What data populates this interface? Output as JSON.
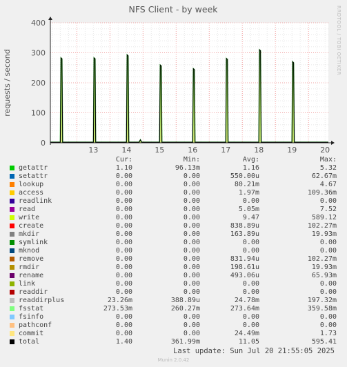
{
  "watermark": "RRDTOOL / TOBI OETIKER",
  "chart_data": {
    "type": "line",
    "title": "NFS Client - by week",
    "xlabel": "",
    "ylabel": "requests / second",
    "xlim": [
      12.2,
      20.6
    ],
    "ylim": [
      0,
      400
    ],
    "x_ticks": [
      "13",
      "14",
      "15",
      "16",
      "17",
      "18",
      "19",
      "20"
    ],
    "x_tick_values": [
      13,
      14,
      15,
      16,
      17,
      18,
      19,
      20
    ],
    "y_ticks": [
      "0",
      "100",
      "200",
      "300",
      "400"
    ],
    "y_tick_values": [
      0,
      100,
      200,
      300,
      400
    ],
    "grid": true,
    "series": [
      {
        "name": "total",
        "color": "#000000",
        "x": [
          12.2,
          12.5,
          12.52,
          12.55,
          12.57,
          12.6,
          13.5,
          13.52,
          13.55,
          13.57,
          13.6,
          14.5,
          14.52,
          14.55,
          14.57,
          14.6,
          14.88,
          14.92,
          14.96,
          15.5,
          15.52,
          15.55,
          15.57,
          15.6,
          16.5,
          16.52,
          16.55,
          16.57,
          16.6,
          17.5,
          17.52,
          17.55,
          17.57,
          17.6,
          18.5,
          18.52,
          18.55,
          18.57,
          18.6,
          19.5,
          19.52,
          19.55,
          19.57,
          19.6,
          20.6
        ],
        "y": [
          2,
          2,
          283,
          280,
          2,
          2,
          2,
          283,
          280,
          2,
          2,
          2,
          293,
          290,
          2,
          2,
          2,
          10,
          2,
          2,
          259,
          256,
          2,
          2,
          2,
          247,
          244,
          2,
          2,
          2,
          281,
          278,
          2,
          2,
          2,
          310,
          307,
          2,
          2,
          2,
          270,
          267,
          2,
          2,
          2
        ]
      }
    ],
    "legend_headers": {
      "cur": "Cur:",
      "min": "Min:",
      "avg": "Avg:",
      "max": "Max:"
    },
    "legend": [
      {
        "name": "getattr",
        "color": "#00cc00",
        "cur": "1.10",
        "min": "96.13m",
        "avg": "1.16",
        "max": "5.32"
      },
      {
        "name": "setattr",
        "color": "#0066b3",
        "cur": "0.00",
        "min": "0.00",
        "avg": "550.00u",
        "max": "62.67m"
      },
      {
        "name": "lookup",
        "color": "#ff8000",
        "cur": "0.00",
        "min": "0.00",
        "avg": "80.21m",
        "max": "4.67"
      },
      {
        "name": "access",
        "color": "#ffcc00",
        "cur": "0.00",
        "min": "0.00",
        "avg": "1.97m",
        "max": "109.36m"
      },
      {
        "name": "readlink",
        "color": "#330099",
        "cur": "0.00",
        "min": "0.00",
        "avg": "0.00",
        "max": "0.00"
      },
      {
        "name": "read",
        "color": "#990099",
        "cur": "0.00",
        "min": "0.00",
        "avg": "5.05m",
        "max": "7.52"
      },
      {
        "name": "write",
        "color": "#ccff00",
        "cur": "0.00",
        "min": "0.00",
        "avg": "9.47",
        "max": "589.12"
      },
      {
        "name": "create",
        "color": "#ff0000",
        "cur": "0.00",
        "min": "0.00",
        "avg": "838.89u",
        "max": "102.27m"
      },
      {
        "name": "mkdir",
        "color": "#808080",
        "cur": "0.00",
        "min": "0.00",
        "avg": "163.89u",
        "max": "19.93m"
      },
      {
        "name": "symlink",
        "color": "#008f00",
        "cur": "0.00",
        "min": "0.00",
        "avg": "0.00",
        "max": "0.00"
      },
      {
        "name": "mknod",
        "color": "#00487d",
        "cur": "0.00",
        "min": "0.00",
        "avg": "0.00",
        "max": "0.00"
      },
      {
        "name": "remove",
        "color": "#b35a00",
        "cur": "0.00",
        "min": "0.00",
        "avg": "831.94u",
        "max": "102.27m"
      },
      {
        "name": "rmdir",
        "color": "#b38f00",
        "cur": "0.00",
        "min": "0.00",
        "avg": "198.61u",
        "max": "19.93m"
      },
      {
        "name": "rename",
        "color": "#6b006b",
        "cur": "0.00",
        "min": "0.00",
        "avg": "493.06u",
        "max": "65.93m"
      },
      {
        "name": "link",
        "color": "#8fb300",
        "cur": "0.00",
        "min": "0.00",
        "avg": "0.00",
        "max": "0.00"
      },
      {
        "name": "readdir",
        "color": "#b30000",
        "cur": "0.00",
        "min": "0.00",
        "avg": "0.00",
        "max": "0.00"
      },
      {
        "name": "readdirplus",
        "color": "#bebebe",
        "cur": "23.26m",
        "min": "388.89u",
        "avg": "24.78m",
        "max": "197.32m"
      },
      {
        "name": "fsstat",
        "color": "#80ff80",
        "cur": "273.53m",
        "min": "260.27m",
        "avg": "273.64m",
        "max": "359.58m"
      },
      {
        "name": "fsinfo",
        "color": "#80c9ff",
        "cur": "0.00",
        "min": "0.00",
        "avg": "0.00",
        "max": "0.00"
      },
      {
        "name": "pathconf",
        "color": "#ffc080",
        "cur": "0.00",
        "min": "0.00",
        "avg": "0.00",
        "max": "0.00"
      },
      {
        "name": "commit",
        "color": "#ffe680",
        "cur": "0.00",
        "min": "0.00",
        "avg": "24.49m",
        "max": "1.73"
      },
      {
        "name": "total",
        "color": "#000000",
        "cur": "1.40",
        "min": "361.99m",
        "avg": "11.05",
        "max": "595.41"
      }
    ]
  },
  "last_update": "Last update: Sun Jul 20 21:55:05 2025",
  "footer": "Munin 2.0.42"
}
